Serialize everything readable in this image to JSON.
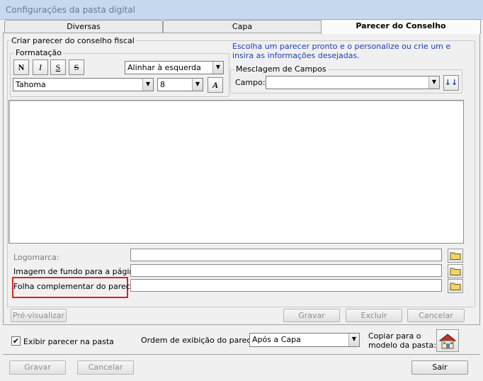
{
  "window": {
    "title": "Configurações da pasta digital"
  },
  "tabs": [
    {
      "label": "Diversas"
    },
    {
      "label": "Capa"
    },
    {
      "label": "Parecer do Conselho"
    }
  ],
  "criar": {
    "legend": "Criar parecer do conselho fiscal",
    "hint": "Escolha um parecer pronto e o personalize ou crie um e insira as informações desejadas."
  },
  "formatacao": {
    "legend": "Formatação",
    "buttons": {
      "bold": "N",
      "italic": "I",
      "underline": "S",
      "strike": "S"
    },
    "alignment": "Alinhar à esquerda",
    "font": "Tahoma",
    "size": "8",
    "font_button": "A"
  },
  "mesclagem": {
    "legend": "Mesclagem de Campos",
    "campo_label": "Campo:",
    "campo_value": "",
    "insert_icon": "↓↓"
  },
  "files": {
    "logomarca_label": "Logomarca:",
    "imagem_label": "Imagem de fundo para a página:",
    "folha_label": "Folha complementar do parecer:"
  },
  "actions": {
    "preview": "Pré-visualizar",
    "gravar": "Gravar",
    "excluir": "Excluir",
    "cancelar": "Cancelar"
  },
  "options": {
    "exibir_label": "Exibir parecer na pasta",
    "exibir_checked": "✔",
    "ordem_label": "Ordem de exibição do parecer:",
    "ordem_value": "Após a Capa",
    "copiar_label_line1": "Copiar para o",
    "copiar_label_line2": "modelo da pasta:"
  },
  "footer": {
    "gravar": "Gravar",
    "cancelar": "Cancelar",
    "sair": "Sair"
  }
}
